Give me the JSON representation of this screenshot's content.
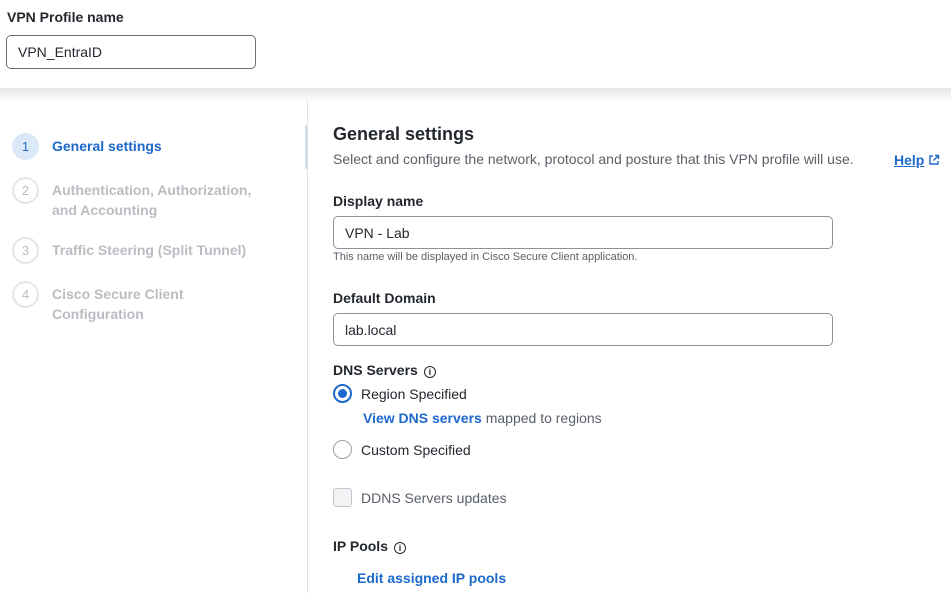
{
  "profile": {
    "label": "VPN Profile name",
    "value": "VPN_EntraID"
  },
  "steps": [
    {
      "num": "1",
      "label": "General settings",
      "active": true
    },
    {
      "num": "2",
      "label": "Authentication, Authorization, and Accounting",
      "active": false
    },
    {
      "num": "3",
      "label": "Traffic Steering (Split Tunnel)",
      "active": false
    },
    {
      "num": "4",
      "label": "Cisco Secure Client Configuration",
      "active": false
    }
  ],
  "main": {
    "title": "General settings",
    "description": "Select and configure the network, protocol and posture that this VPN profile will use.",
    "help_label": "Help"
  },
  "display_name": {
    "label": "Display name",
    "value": "VPN - Lab",
    "hint": "This name will be displayed in Cisco Secure Client application."
  },
  "default_domain": {
    "label": "Default Domain",
    "value": "lab.local"
  },
  "dns": {
    "label": "DNS Servers",
    "options": [
      {
        "label": "Region Specified",
        "checked": true
      },
      {
        "label": "Custom Specified",
        "checked": false
      }
    ],
    "view_link": "View DNS servers",
    "view_suffix": "mapped to regions"
  },
  "ddns": {
    "label": "DDNS Servers updates",
    "checked": false
  },
  "ip_pools": {
    "label": "IP Pools",
    "edit_link": "Edit assigned IP pools"
  },
  "colors": {
    "accent": "#1d69cc",
    "inactive_step": "#b9bdc2"
  }
}
